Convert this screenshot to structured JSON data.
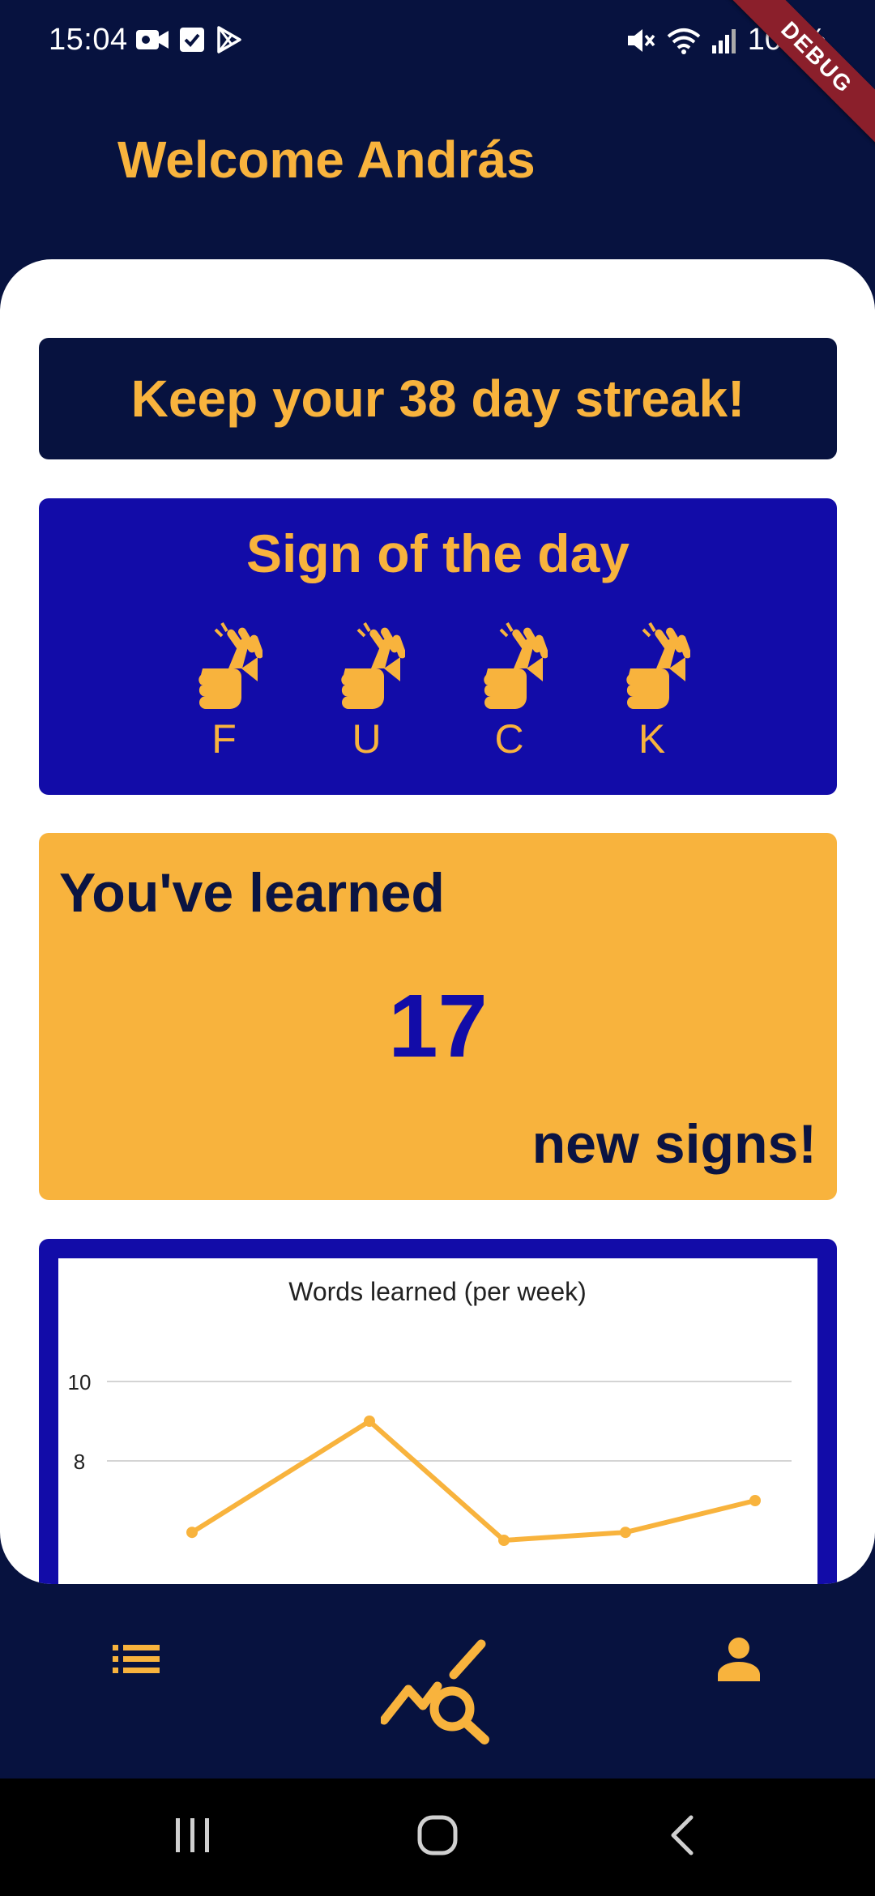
{
  "status_bar": {
    "time": "15:04",
    "battery": "100%",
    "left_icons": [
      "video-icon",
      "check-square-icon",
      "play-store-icon"
    ],
    "right_icons": [
      "mute-icon",
      "wifi-icon",
      "signal-icon"
    ]
  },
  "debug_banner": "DEBUG",
  "header": {
    "welcome": "Welcome András"
  },
  "streak": {
    "text": "Keep your 38 day streak!"
  },
  "sign_of_day": {
    "title": "Sign of the day",
    "letters": [
      "F",
      "U",
      "C",
      "K"
    ]
  },
  "learned": {
    "title": "You've learned",
    "count": "17",
    "suffix": "new signs!"
  },
  "chart_data": {
    "type": "line",
    "title": "Words learned (per week)",
    "xlabel": "",
    "ylabel": "",
    "y_ticks": [
      8,
      10
    ],
    "ylim_visible": [
      7.0,
      10.5
    ],
    "series": [
      {
        "values": [
          6.2,
          9.0,
          6.0,
          6.2,
          7.0
        ],
        "color": "#f8b33d"
      }
    ],
    "grid": true
  },
  "bottom_nav": {
    "items": [
      "list-icon",
      "analytics-search-icon",
      "person-icon"
    ],
    "active": "analytics-search-icon"
  },
  "system_nav": [
    "recents-icon",
    "home-icon",
    "back-icon"
  ],
  "colors": {
    "navy": "#07123f",
    "accent": "#f8b33d",
    "royal_blue": "#120ca8",
    "white": "#ffffff"
  }
}
